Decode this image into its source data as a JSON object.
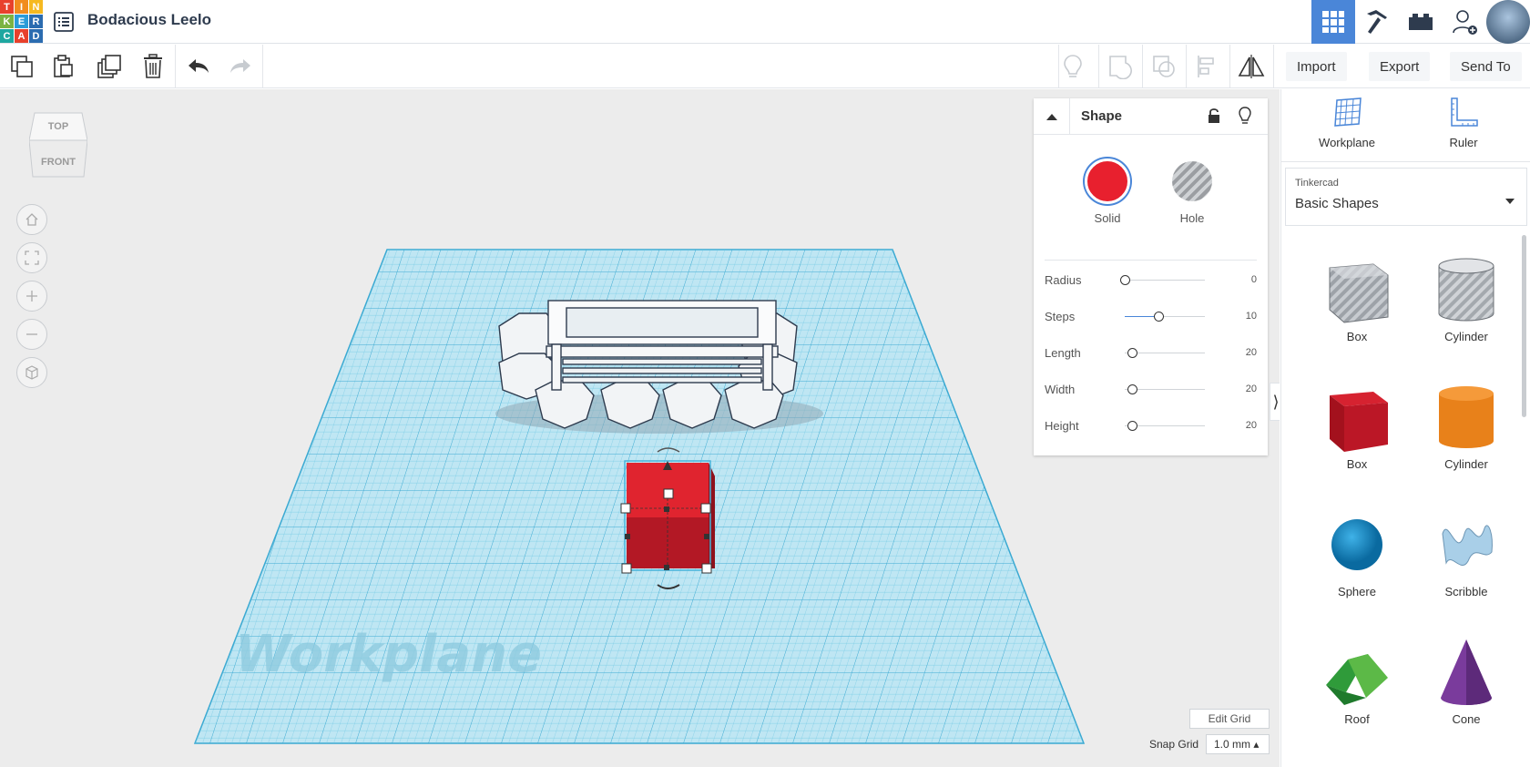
{
  "app": {
    "logo_letters": [
      "T",
      "I",
      "N",
      "K",
      "E",
      "R",
      "C",
      "A",
      "D"
    ],
    "logo_colors": [
      "#e8412c",
      "#f18c1e",
      "#f6b920",
      "#7cb342",
      "#2b9cd8",
      "#2b6cb0",
      "#1ea7a0",
      "#e8412c",
      "#2b6cb0"
    ],
    "project_title": "Bodacious Leelo"
  },
  "topbar": {
    "icons": [
      "3d-design-grid-icon",
      "minecraft-pickaxe-icon",
      "lego-brick-icon",
      "add-user-icon",
      "user-avatar"
    ]
  },
  "toolbar": {
    "import_label": "Import",
    "export_label": "Export",
    "sendto_label": "Send To"
  },
  "viewcube": {
    "top": "TOP",
    "front": "FRONT"
  },
  "shape_panel": {
    "title": "Shape",
    "solid_label": "Solid",
    "hole_label": "Hole",
    "solid_color": "#e8202e",
    "props": [
      {
        "label": "Radius",
        "value": "0",
        "fraction": 0.0
      },
      {
        "label": "Steps",
        "value": "10",
        "fraction": 0.42
      },
      {
        "label": "Length",
        "value": "20",
        "fraction": 0.0
      },
      {
        "label": "Width",
        "value": "20",
        "fraction": 0.0
      },
      {
        "label": "Height",
        "value": "20",
        "fraction": 0.0
      }
    ]
  },
  "workplane": {
    "watermark": "Workplane",
    "edit_grid_label": "Edit Grid",
    "snap_label": "Snap Grid",
    "snap_value": "1.0 mm ▴"
  },
  "sidebar": {
    "workplane_label": "Workplane",
    "ruler_label": "Ruler",
    "library_category": "Tinkercad",
    "library_name": "Basic Shapes",
    "shapes": [
      {
        "label": "Box",
        "kind": "box-hole"
      },
      {
        "label": "Cylinder",
        "kind": "cylinder-hole"
      },
      {
        "label": "Box",
        "kind": "box-red"
      },
      {
        "label": "Cylinder",
        "kind": "cylinder-orange"
      },
      {
        "label": "Sphere",
        "kind": "sphere"
      },
      {
        "label": "Scribble",
        "kind": "scribble"
      },
      {
        "label": "Roof",
        "kind": "roof"
      },
      {
        "label": "Cone",
        "kind": "cone"
      }
    ]
  }
}
